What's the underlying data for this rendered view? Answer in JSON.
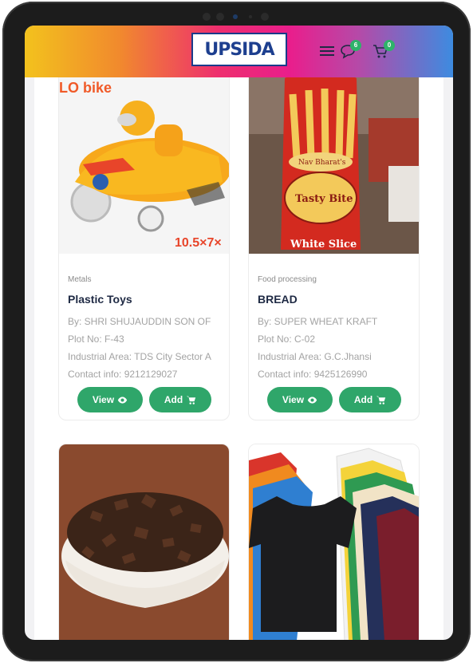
{
  "header": {
    "logo_text": "UPSIDA",
    "chat_count": "6",
    "cart_count": "0"
  },
  "products": [
    {
      "category": "Metals",
      "title": "Plastic Toys",
      "by": "By: SHRI SHUJAUDDIN SON OF",
      "plot": "Plot No: F-43",
      "area": "Industrial Area: TDS City Sector A",
      "contact": "Contact info: 9212129027",
      "image_text_top": "LO bike",
      "image_text_bottom": "10.5×7×",
      "view_label": "View",
      "add_label": "Add"
    },
    {
      "category": "Food processing",
      "title": "BREAD",
      "by": "By: SUPER WHEAT KRAFT",
      "plot": "Plot No: C-02",
      "area": "Industrial Area: G.C.Jhansi",
      "contact": "Contact info: 9425126990",
      "image_text_brand": "Nav Bharat's",
      "image_text_name": "Tasty Bite",
      "image_text_bottom": "White Slice",
      "view_label": "View",
      "add_label": "Add"
    }
  ],
  "colors": {
    "accent_green": "#2fa66a",
    "title_navy": "#1f2a44"
  }
}
